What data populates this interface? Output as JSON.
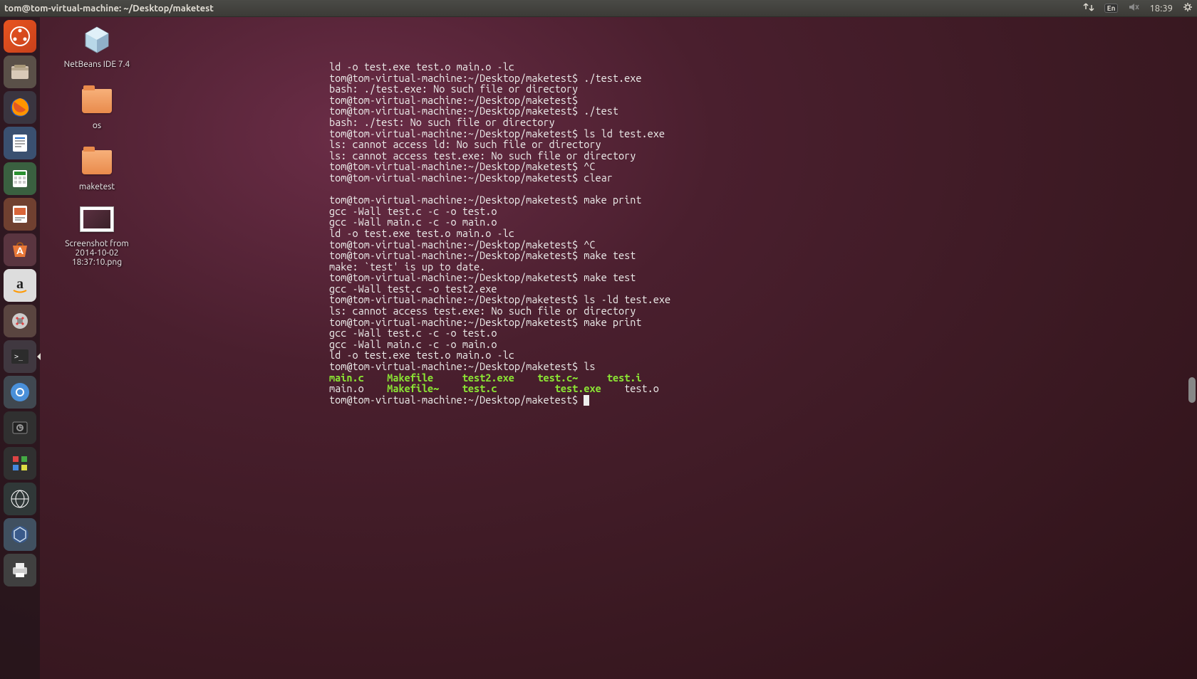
{
  "top_panel": {
    "title": "tom@tom-virtual-machine: ~/Desktop/maketest",
    "time": "18:39",
    "lang": "En"
  },
  "desktop_icons": {
    "netbeans": "NetBeans IDE 7.4",
    "os_folder": "os",
    "maketest_folder": "maketest",
    "screenshot": "Screenshot from 2014-10-02 18:37:10.png"
  },
  "terminal": {
    "prompt": "tom@tom-virtual-machine:~/Desktop/maketest$ ",
    "lines": [
      {
        "t": "ld -o test.exe test.o main.o -lc"
      },
      {
        "t": "tom@tom-virtual-machine:~/Desktop/maketest$ ./test.exe"
      },
      {
        "t": "bash: ./test.exe: No such file or directory"
      },
      {
        "t": "tom@tom-virtual-machine:~/Desktop/maketest$ "
      },
      {
        "t": "tom@tom-virtual-machine:~/Desktop/maketest$ ./test"
      },
      {
        "t": "bash: ./test: No such file or directory"
      },
      {
        "t": "tom@tom-virtual-machine:~/Desktop/maketest$ ls ld test.exe"
      },
      {
        "t": "ls: cannot access ld: No such file or directory"
      },
      {
        "t": "ls: cannot access test.exe: No such file or directory"
      },
      {
        "t": "tom@tom-virtual-machine:~/Desktop/maketest$ ^C"
      },
      {
        "t": "tom@tom-virtual-machine:~/Desktop/maketest$ clear"
      },
      {
        "t": ""
      },
      {
        "t": "tom@tom-virtual-machine:~/Desktop/maketest$ make print"
      },
      {
        "t": "gcc -Wall test.c -c -o test.o"
      },
      {
        "t": "gcc -Wall main.c -c -o main.o"
      },
      {
        "t": "ld -o test.exe test.o main.o -lc"
      },
      {
        "t": "tom@tom-virtual-machine:~/Desktop/maketest$ ^C"
      },
      {
        "t": "tom@tom-virtual-machine:~/Desktop/maketest$ make test"
      },
      {
        "t": "make: `test' is up to date."
      },
      {
        "t": "tom@tom-virtual-machine:~/Desktop/maketest$ make test"
      },
      {
        "t": "gcc -Wall test.c -o test2.exe"
      },
      {
        "t": "tom@tom-virtual-machine:~/Desktop/maketest$ ls -ld test.exe"
      },
      {
        "t": "ls: cannot access test.exe: No such file or directory"
      },
      {
        "t": "tom@tom-virtual-machine:~/Desktop/maketest$ make print"
      },
      {
        "t": "gcc -Wall test.c -c -o test.o"
      },
      {
        "t": "gcc -Wall main.c -c -o main.o"
      },
      {
        "t": "ld -o test.exe test.o main.o -lc"
      },
      {
        "t": "tom@tom-virtual-machine:~/Desktop/maketest$ ls"
      }
    ],
    "ls_row1": [
      {
        "name": "main.c",
        "cls": "green",
        "pad": 8
      },
      {
        "name": "Makefile",
        "cls": "green",
        "pad": 11
      },
      {
        "name": "test2.exe",
        "cls": "green",
        "pad": 11
      },
      {
        "name": "test.c~",
        "cls": "green",
        "pad": 10
      },
      {
        "name": "test.i",
        "cls": "green",
        "pad": 0
      }
    ],
    "ls_row2": [
      {
        "name": "main.o",
        "cls": "",
        "pad": 8
      },
      {
        "name": "Makefile~",
        "cls": "green",
        "pad": 11
      },
      {
        "name": "test.c",
        "cls": "green",
        "pad": 14
      },
      {
        "name": "test.exe",
        "cls": "green",
        "pad": 10
      },
      {
        "name": "test.o",
        "cls": "",
        "pad": 0
      }
    ]
  }
}
